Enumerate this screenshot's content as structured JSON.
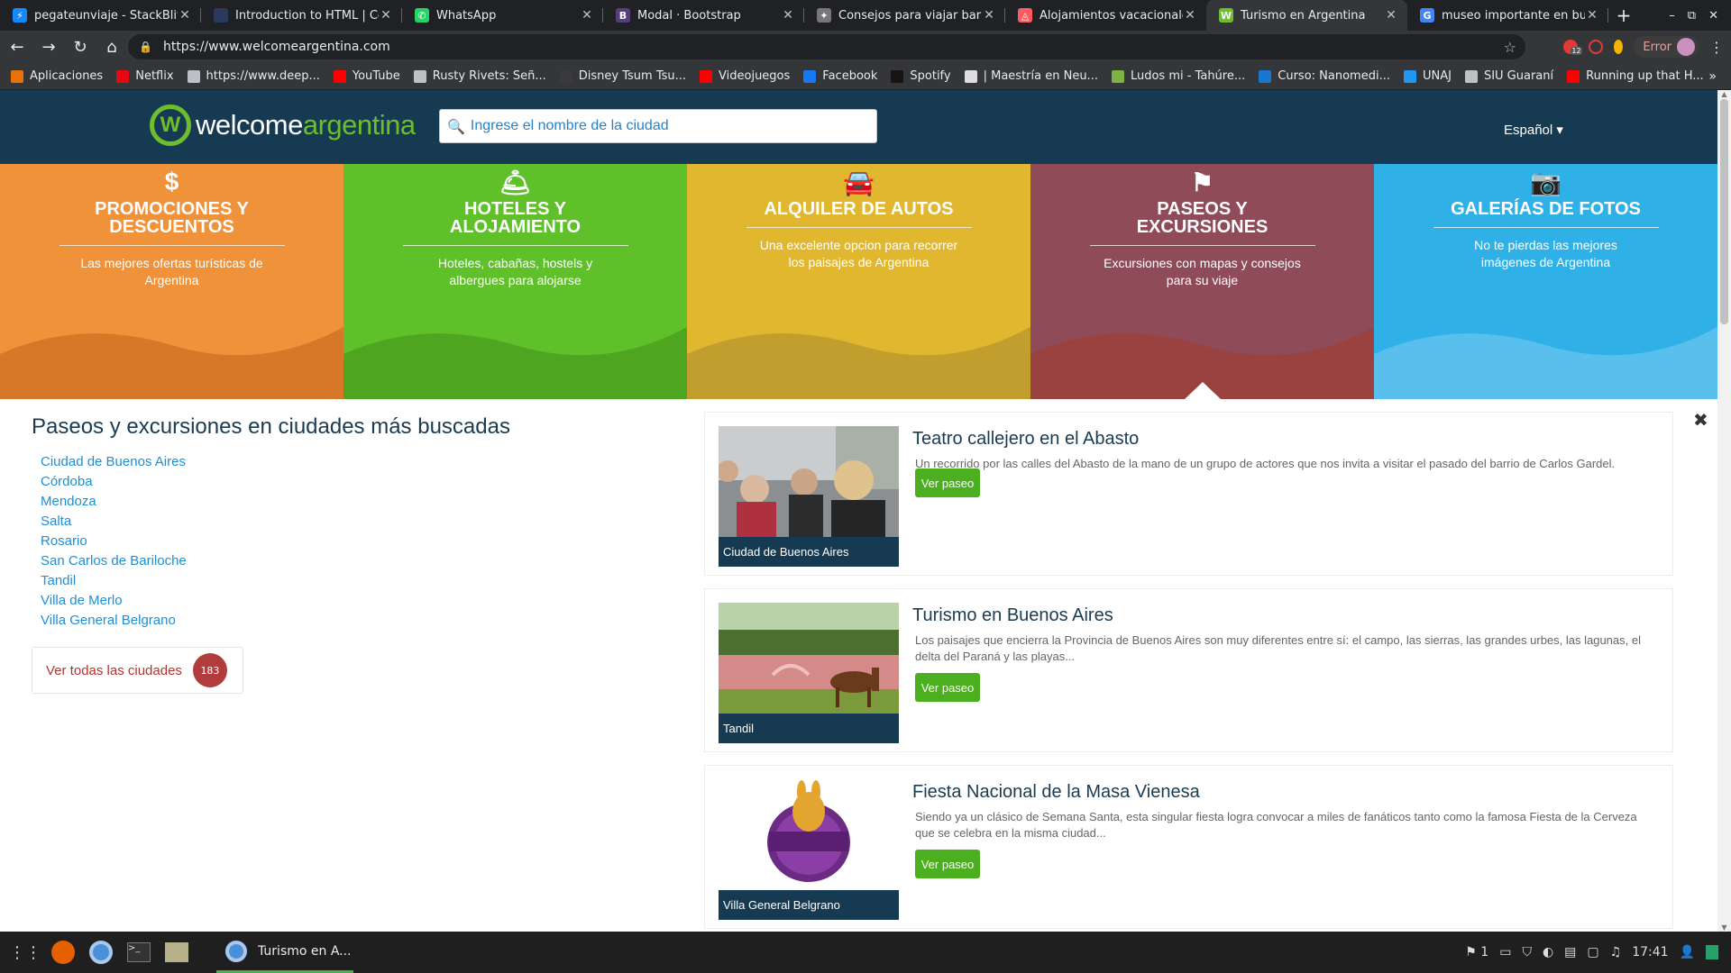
{
  "browser": {
    "tabs": [
      {
        "title": "pegateunviaje - StackBlitz",
        "icon": "stackblitz-icon",
        "color": "#1389fd",
        "glyph": "⚡"
      },
      {
        "title": "Introduction to HTML | Cod",
        "icon": "codecademy-icon",
        "color": "#2a3a5c",
        "glyph": ""
      },
      {
        "title": "WhatsApp",
        "icon": "whatsapp-icon",
        "color": "#25d366",
        "glyph": "✆"
      },
      {
        "title": "Modal · Bootstrap",
        "icon": "bootstrap-icon",
        "color": "#563d7c",
        "glyph": "B"
      },
      {
        "title": "Consejos para viajar barato",
        "icon": "globe-icon",
        "color": "#777777",
        "glyph": "✦"
      },
      {
        "title": "Alojamientos vacacionales",
        "icon": "airbnb-icon",
        "color": "#ff5a5f",
        "glyph": "◬"
      },
      {
        "title": "Turismo en Argentina",
        "icon": "welcomeargentina-icon",
        "color": "#6dbd2c",
        "glyph": "W"
      },
      {
        "title": "museo importante en bue",
        "icon": "google-icon",
        "color": "#4285f4",
        "glyph": "G"
      }
    ],
    "url": "https://www.welcomeargentina.com",
    "error_label": "Error",
    "extension_badge": "12",
    "bookmarks": [
      {
        "label": "Aplicaciones",
        "icon": "apps-grid-icon",
        "color": "#e8710a"
      },
      {
        "label": "Netflix",
        "icon": "netflix-icon",
        "color": "#e50914"
      },
      {
        "label": "https://www.deep...",
        "icon": "globe-icon",
        "color": "#bdc1c6"
      },
      {
        "label": "YouTube",
        "icon": "youtube-icon",
        "color": "#ff0000"
      },
      {
        "label": "Rusty Rivets: Señ...",
        "icon": "globe-icon",
        "color": "#bdc1c6"
      },
      {
        "label": "Disney Tsum Tsu...",
        "icon": "disney-icon",
        "color": "#3a3a3a"
      },
      {
        "label": "Videojuegos",
        "icon": "youtube-icon",
        "color": "#ff0000"
      },
      {
        "label": "Facebook",
        "icon": "facebook-icon",
        "color": "#1877f2"
      },
      {
        "label": "Spotify",
        "icon": "spotify-icon",
        "color": "#191414"
      },
      {
        "label": "| Maestría en Neu...",
        "icon": "document-icon",
        "color": "#dddddd"
      },
      {
        "label": "Ludos mi - Tahúre...",
        "icon": "bookmark-icon",
        "color": "#7cb342"
      },
      {
        "label": "Curso: Nanomedi...",
        "icon": "course-icon",
        "color": "#1976d2"
      },
      {
        "label": "UNAJ",
        "icon": "unaj-icon",
        "color": "#2196f3"
      },
      {
        "label": "SIU Guaraní",
        "icon": "globe-icon",
        "color": "#bdc1c6"
      },
      {
        "label": "Running up that H...",
        "icon": "youtube-icon",
        "color": "#ff0000"
      }
    ]
  },
  "site": {
    "logo": {
      "part1": "welcome",
      "part2": "argentina",
      "mark": "W"
    },
    "search_placeholder": "Ingrese el nombre de la ciudad",
    "language": "Español ▾",
    "categories": [
      {
        "title": "Promociones y descuentos",
        "desc": "Las mejores ofertas turísticas de Argentina",
        "icon": "dollar-icon",
        "glyph": "$",
        "bg": "#f0923a",
        "deco": "#c2621a"
      },
      {
        "title": "Hoteles y alojamiento",
        "desc": "Hoteles, cabañas, hostels y albergues para alojarse",
        "icon": "bell-icon",
        "glyph": "🛎",
        "bg": "#5fc02a",
        "deco": "#3f8f17"
      },
      {
        "title": "Alquiler de autos",
        "desc": "Una excelente opcion para recorrer los paisajes de Argentina",
        "icon": "car-icon",
        "glyph": "🚘",
        "bg": "#e1b72f",
        "deco": "#a88a2c"
      },
      {
        "title": "Paseos y excursiones",
        "desc": "Excursiones con mapas y consejos para su viaje",
        "icon": "signpost-icon",
        "glyph": "⚑",
        "bg": "#8f4b57",
        "deco": "#a23c2c"
      },
      {
        "title": "Galerías de fotos",
        "desc": "No te pierdas las mejores imágenes de Argentina",
        "icon": "camera-icon",
        "glyph": "📷",
        "bg": "#2fb1e8",
        "deco": "#7ccaf0"
      }
    ],
    "left_title": "Paseos y excursiones en ciudades más buscadas",
    "cities": [
      "Ciudad de Buenos Aires",
      "Córdoba",
      "Mendoza",
      "Salta",
      "Rosario",
      "San Carlos de Bariloche",
      "Tandil",
      "Villa de Merlo",
      "Villa General Belgrano"
    ],
    "all_cities_label": "Ver todas las ciudades",
    "all_cities_count": "183",
    "tours": [
      {
        "title": "Teatro callejero en el Abasto",
        "desc": "Un recorrido por las calles del Abasto de la mano de un grupo de actores que nos invita a visitar el pasado del barrio de Carlos Gardel.",
        "city": "Ciudad de Buenos Aires",
        "button": "Ver paseo"
      },
      {
        "title": "Turismo en Buenos Aires",
        "desc": "Los paisajes que encierra la Provincia de Buenos Aires son muy diferentes entre sí: el campo, las sierras, las grandes urbes, las lagunas, el delta del Paraná y las playas...",
        "city": "Tandil",
        "button": "Ver paseo"
      },
      {
        "title": "Fiesta Nacional de la Masa Vienesa",
        "desc": "Siendo ya un clásico de Semana Santa, esta singular fiesta logra convocar a miles de fanáticos tanto como la famosa Fiesta de la Cerveza que se celebra en la misma ciudad...",
        "city": "Villa General Belgrano",
        "button": "Ver paseo"
      }
    ]
  },
  "taskbar": {
    "task_label": "Turismo en A...",
    "workspace": "1",
    "clock": "17:41"
  }
}
